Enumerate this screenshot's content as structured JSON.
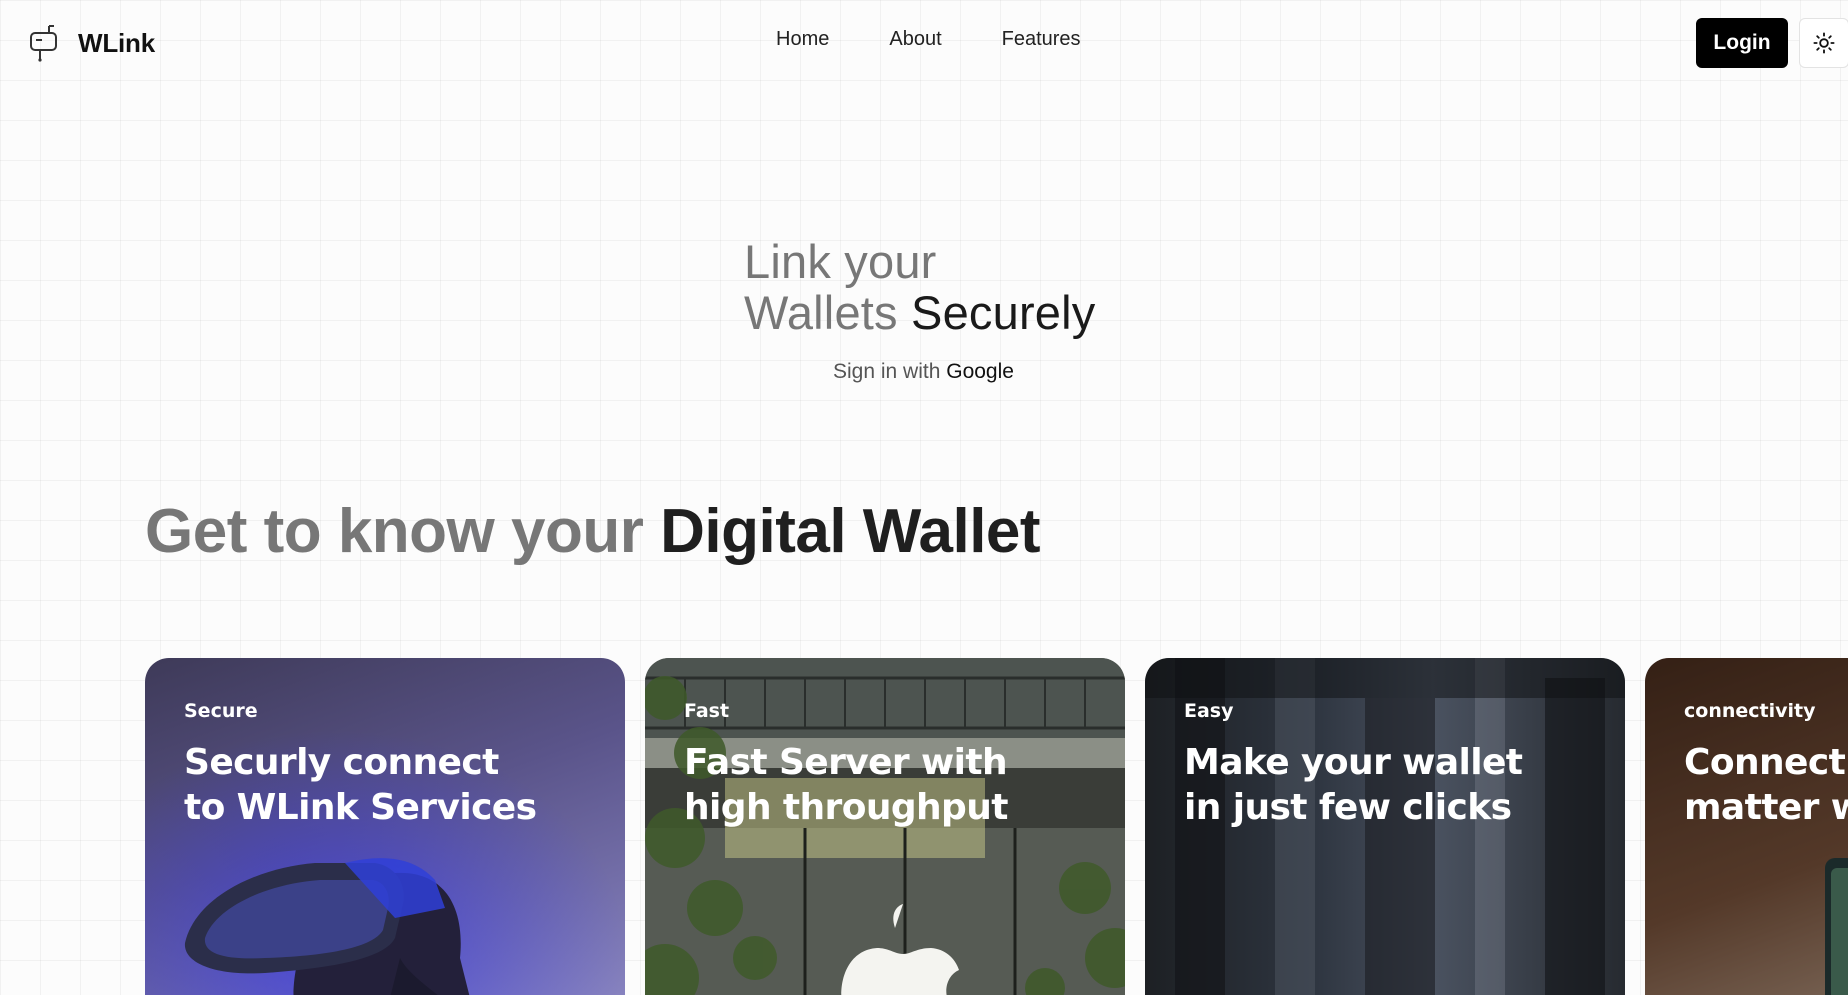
{
  "brand": {
    "name": "WLink",
    "logo_icon": "mailbox-icon"
  },
  "nav": {
    "items": [
      {
        "label": "Home"
      },
      {
        "label": "About"
      },
      {
        "label": "Features"
      }
    ]
  },
  "header": {
    "login_label": "Login",
    "theme_icon": "sun-icon"
  },
  "hero": {
    "title_line1": "Link your",
    "title_line2_light": "Wallets",
    "title_line2_strong": "Securely",
    "subtitle_prefix": "Sign in with",
    "subtitle_provider": "Google"
  },
  "section": {
    "title_light": "Get to know your",
    "title_strong": "Digital Wallet"
  },
  "cards": [
    {
      "tag": "Secure",
      "headline_line1": "Securly connect",
      "headline_line2": "to WLink Services"
    },
    {
      "tag": "Fast",
      "headline_line1": "Fast Server with",
      "headline_line2": "high throughput"
    },
    {
      "tag": "Easy",
      "headline_line1": "Make your wallet",
      "headline_line2": "in just few clicks"
    },
    {
      "tag": "connectivity",
      "headline_line1": "Connect y",
      "headline_line2": "matter wh"
    }
  ]
}
